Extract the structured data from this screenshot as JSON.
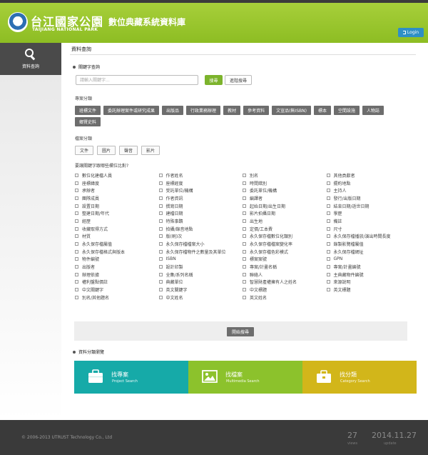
{
  "header": {
    "logo_zh": "台江國家公園",
    "logo_en": "TAIJIANG NATIONAL PARK",
    "site_title": "數位典藏系統資料庫",
    "login_label": "Login"
  },
  "sidebar": {
    "items": [
      {
        "label": "資料查詢",
        "icon": "search-icon"
      }
    ]
  },
  "main": {
    "page_title": "資料查詢",
    "keyword": {
      "heading": "關鍵字查詢",
      "placeholder": "請輸入關鍵字...",
      "search_label": "搜尋",
      "advanced_label": "進階搜尋"
    },
    "category": {
      "heading": "專案分類",
      "row1": [
        "班標文件",
        "委託辦理案件或研究成果",
        "出版品",
        "行政業務辦理",
        "教材",
        "參考資料",
        "文宣品(無ISBN)",
        "標本",
        "空間設施",
        "人物誌"
      ],
      "row2": [
        "鄉賢史料"
      ]
    },
    "file_type": {
      "heading": "檔案分類",
      "items": [
        "文件",
        "圖片",
        "聲音",
        "影片"
      ]
    },
    "fields_heading": "要讓關鍵字跟哪些欄位比對?",
    "fields": [
      [
        "數位化建檔人員",
        "作者姓名",
        "別名",
        "其他貢獻者"
      ],
      [
        "座標緯度",
        "座標經度",
        "時間錯別",
        "擺約地點"
      ],
      [
        "承辦者",
        "受託單位/機構",
        "委託單位/機構",
        "主持人"
      ],
      [
        "團隊成員",
        "作者資訊",
        "編譯者",
        "發行/出版日期"
      ],
      [
        "設置日期",
        "撰寫日期",
        "起始日期/出生日期",
        "結束日期/逝世日期"
      ],
      [
        "整建日期/年代",
        "建檔日期",
        "影片拍攝日期",
        "學歷"
      ],
      [
        "經歷",
        "特殊事蹟",
        "出生地",
        "備註"
      ],
      [
        "收藏取得方式",
        "拍攝/錄音地點",
        "定價/工本費",
        "尺寸"
      ],
      [
        "材質",
        "版(刷)次",
        "永久保存檔數位化類別",
        "永久保存檔播放/演出時間長度"
      ],
      [
        "永久保存檔屬值",
        "永久保存檔檔案大小",
        "永久保存檔檔案變化率",
        "錄製影覽檔屬值"
      ],
      [
        "永久保存檔格式與版本",
        "永久保存檔物件之數量及其單位",
        "永久保存檔色彩模式",
        "永久保存檔網址"
      ],
      [
        "物件編號",
        "ISBN",
        "標案案號",
        "GPN"
      ],
      [
        "出版者",
        "設計印製",
        "專案/計畫名稱",
        "專案/計畫編號"
      ],
      [
        "辦理依據",
        "全集/系列名稱",
        "聯絡人",
        "主典藏物件編號"
      ],
      [
        "權利盤點價註",
        "典藏單位",
        "智慧財產權擁有人之姓名",
        "來源說明"
      ],
      [
        "中文關鍵字",
        "英文關鍵字",
        "中文標題",
        "英文標題"
      ],
      [
        "別名/其他題名",
        "中文姓名",
        "英文姓名",
        ""
      ]
    ],
    "submit_label": "開始搜尋",
    "browse": {
      "heading": "資料分類瀏覽",
      "cards": [
        {
          "title": "找專案",
          "subtitle": "Project Search",
          "color": "#16aaa8",
          "icon": "briefcase-icon"
        },
        {
          "title": "找檔案",
          "subtitle": "Multimedia Search",
          "color": "#8cc22c",
          "icon": "image-icon"
        },
        {
          "title": "找分類",
          "subtitle": "Category Search",
          "color": "#d2b61a",
          "icon": "folder-bag-icon"
        }
      ]
    }
  },
  "footer": {
    "copyright": "© 2006-2013 UTRUST Technology Co., Ltd",
    "views_count": "27",
    "views_label": "views",
    "update_date": "2014.11.27",
    "update_label": "update"
  },
  "colors": {
    "header_green": "#8dbd23",
    "search_green": "#7cb32c",
    "login_blue": "#2e8fc6",
    "tag_gray": "#6d6d6d",
    "footer_dark": "#3a3a3a"
  }
}
